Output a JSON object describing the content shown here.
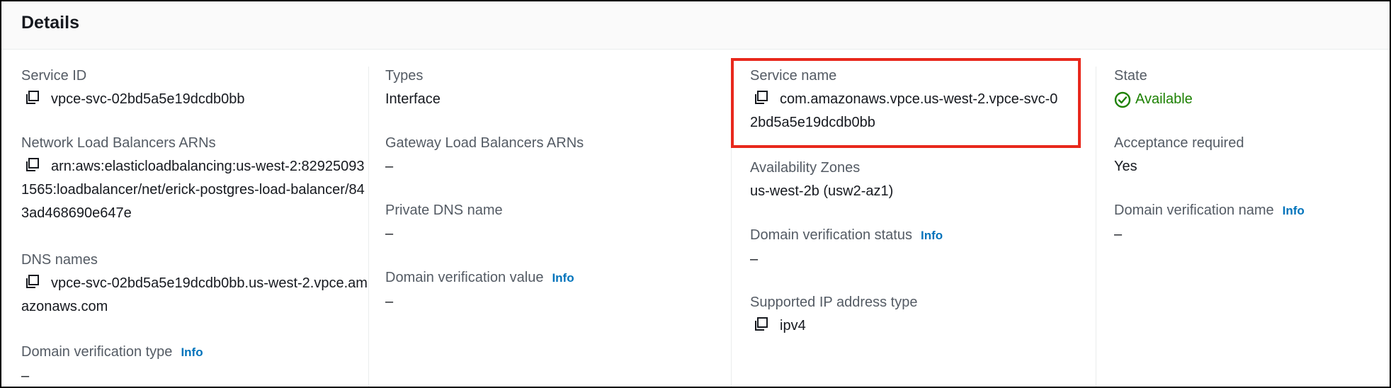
{
  "panel": {
    "title": "Details"
  },
  "columns": [
    {
      "fields": [
        {
          "label": "Service ID",
          "value": "vpce-svc-02bd5a5e19dcdb0bb"
        },
        {
          "label": "Network Load Balancers ARNs",
          "value": "arn:aws:elasticloadbalancing:us-west-2:829250931565:loadbalancer/net/erick-postgres-load-balancer/843ad468690e647e"
        },
        {
          "label": "DNS names",
          "value": "vpce-svc-02bd5a5e19dcdb0bb.us-west-2.vpce.amazonaws.com"
        },
        {
          "label": "Domain verification type",
          "info": "Info",
          "value": "–"
        }
      ]
    },
    {
      "fields": [
        {
          "label": "Types",
          "value": "Interface"
        },
        {
          "label": "Gateway Load Balancers ARNs",
          "value": "–"
        },
        {
          "label": "Private DNS name",
          "value": "–"
        },
        {
          "label": "Domain verification value",
          "info": "Info",
          "value": "–"
        }
      ]
    },
    {
      "fields": [
        {
          "label": "Service name",
          "value": "com.amazonaws.vpce.us-west-2.vpce-svc-02bd5a5e19dcdb0bb"
        },
        {
          "label": "Availability Zones",
          "value": "us-west-2b (usw2-az1)"
        },
        {
          "label": "Domain verification status",
          "info": "Info",
          "value": "–"
        },
        {
          "label": "Supported IP address type",
          "value": "ipv4"
        }
      ]
    },
    {
      "fields": [
        {
          "label": "State",
          "value": "Available"
        },
        {
          "label": "Acceptance required",
          "value": "Yes"
        },
        {
          "label": "Domain verification name",
          "info": "Info",
          "value": "–"
        }
      ]
    }
  ],
  "colors": {
    "accent_link": "#0073bb",
    "status_available": "#1d8102",
    "highlight": "#e8281c"
  },
  "icons": {
    "copy": "copy-icon",
    "status": "check-circle-icon"
  }
}
